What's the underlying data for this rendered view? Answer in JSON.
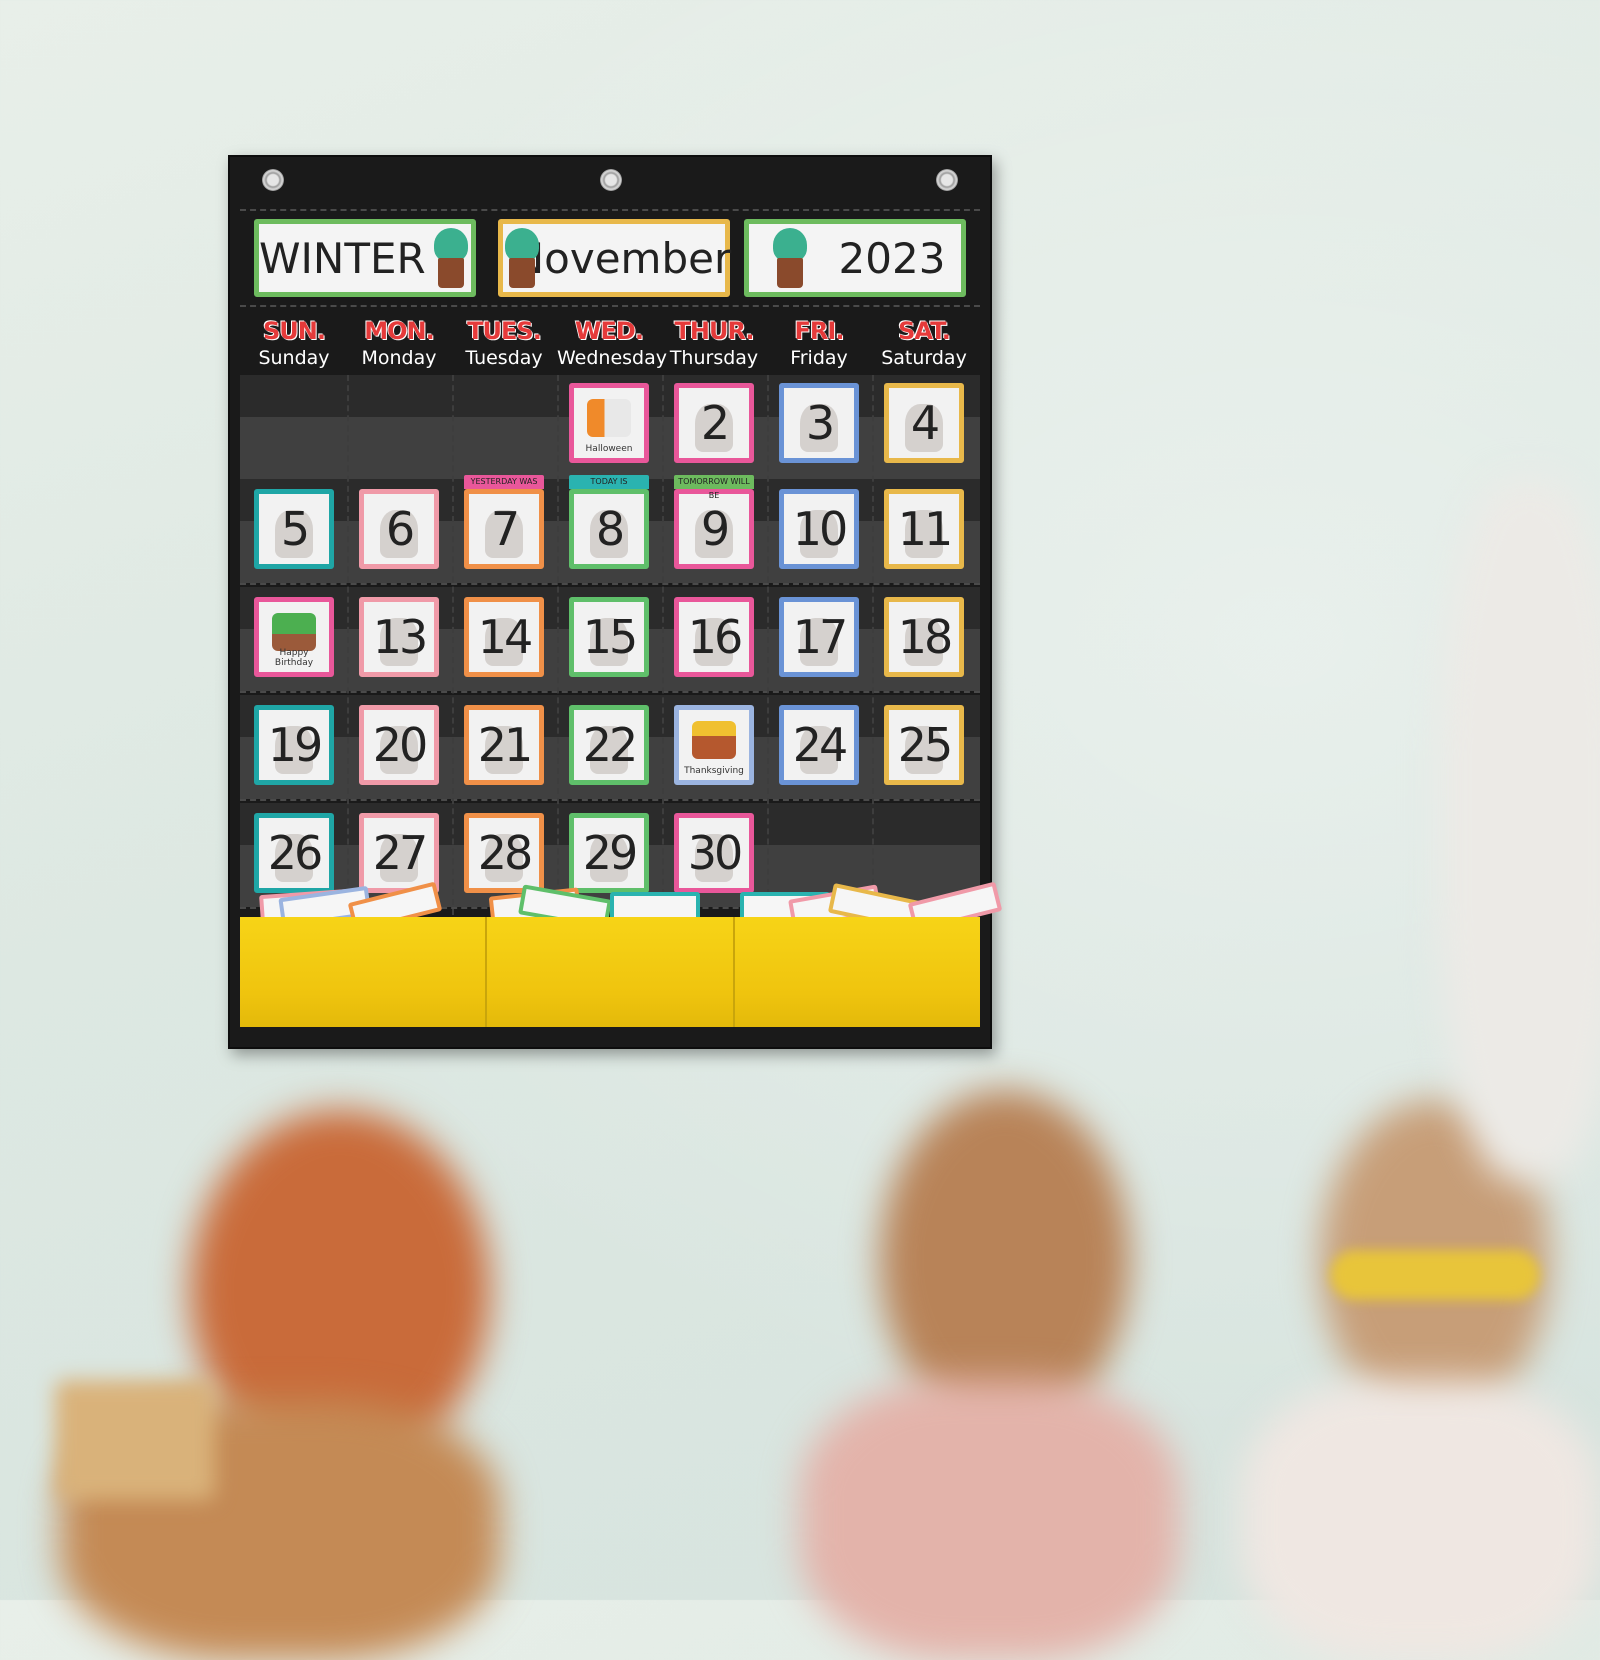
{
  "scene": {
    "description": "Classroom wall with a black pocket calendar chart above blurred children",
    "colors": {
      "wall": "#dde8e2",
      "chart": "#1a1a1a",
      "pocket_bins": "#f2c811",
      "day_abbr": "#e53a3a"
    }
  },
  "calendar": {
    "header": {
      "season": "WINTER",
      "month": "November",
      "year": "2023"
    },
    "header_colors": {
      "season": "#6dbb5e",
      "month": "#e8b84a",
      "year": "#6dbb5e"
    },
    "days": [
      {
        "abbr": "SUN.",
        "full": "Sunday"
      },
      {
        "abbr": "MON.",
        "full": "Monday"
      },
      {
        "abbr": "TUES.",
        "full": "Tuesday"
      },
      {
        "abbr": "WED.",
        "full": "Wednesday"
      },
      {
        "abbr": "THUR.",
        "full": "Thursday"
      },
      {
        "abbr": "FRI.",
        "full": "Friday"
      },
      {
        "abbr": "SAT.",
        "full": "Saturday"
      }
    ],
    "weeks": [
      [
        null,
        null,
        null,
        {
          "label": "",
          "caption": "Halloween",
          "color": "#e9579a",
          "icon": "halloween-ghost-icon"
        },
        {
          "label": "2",
          "color": "#e9579a"
        },
        {
          "label": "3",
          "color": "#6a93d6"
        },
        {
          "label": "4",
          "color": "#e8b84a"
        }
      ],
      [
        {
          "label": "5",
          "color": "#1fa6a6"
        },
        {
          "label": "6",
          "color": "#f09aa8"
        },
        {
          "label": "7",
          "color": "#f09048",
          "tag": "YESTERDAY WAS",
          "tag_color": "#e9579a"
        },
        {
          "label": "8",
          "color": "#5fbf6a",
          "tag": "TODAY IS",
          "tag_color": "#2ab3b0"
        },
        {
          "label": "9",
          "color": "#e9579a",
          "tag": "TOMORROW WILL BE",
          "tag_color": "#6dbb5e"
        },
        {
          "label": "10",
          "color": "#6a93d6"
        },
        {
          "label": "11",
          "color": "#e8b84a"
        }
      ],
      [
        {
          "label": "",
          "caption": "Happy Birthday",
          "color": "#e9579a",
          "icon": "birthday-cactus-icon"
        },
        {
          "label": "13",
          "color": "#f09aa8"
        },
        {
          "label": "14",
          "color": "#f09048"
        },
        {
          "label": "15",
          "color": "#5fbf6a"
        },
        {
          "label": "16",
          "color": "#e9579a"
        },
        {
          "label": "17",
          "color": "#6a93d6"
        },
        {
          "label": "18",
          "color": "#e8b84a"
        }
      ],
      [
        {
          "label": "19",
          "color": "#1fa6a6"
        },
        {
          "label": "20",
          "color": "#f09aa8"
        },
        {
          "label": "21",
          "color": "#f09048"
        },
        {
          "label": "22",
          "color": "#5fbf6a"
        },
        {
          "label": "",
          "caption": "Thanksgiving",
          "color": "#9bb4e0",
          "icon": "thanksgiving-turkey-icon"
        },
        {
          "label": "24",
          "color": "#6a93d6"
        },
        {
          "label": "25",
          "color": "#e8b84a"
        }
      ],
      [
        {
          "label": "26",
          "color": "#1fa6a6"
        },
        {
          "label": "27",
          "color": "#f09aa8"
        },
        {
          "label": "28",
          "color": "#f09048"
        },
        {
          "label": "29",
          "color": "#5fbf6a"
        },
        {
          "label": "30",
          "color": "#e9579a"
        },
        null,
        null
      ]
    ],
    "storage_pockets": 3
  }
}
